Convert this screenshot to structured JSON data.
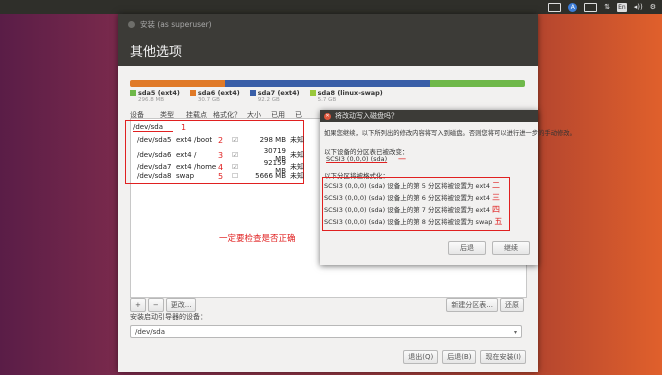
{
  "tray": {
    "acc": "A",
    "box": "En",
    "vol": "◂))",
    "gear": "⚙"
  },
  "window": {
    "title": "安装 (as superuser)",
    "page_title": "其他选项"
  },
  "disk_bar": {
    "segments": [
      {
        "color": "#e07a28",
        "fraction": 0.24
      },
      {
        "color": "#3a5fa8",
        "fraction": 0.52
      },
      {
        "color": "#6fb84a",
        "fraction": 0.24
      }
    ]
  },
  "legend": [
    {
      "label": "sda5 (ext4)",
      "size": "296.8 MB",
      "color": "#6fb84a"
    },
    {
      "label": "sda6 (ext4)",
      "size": "30.7 GB",
      "color": "#e07a28"
    },
    {
      "label": "sda7 (ext4)",
      "size": "92.2 GB",
      "color": "#3a5fa8"
    },
    {
      "label": "sda8 (linux-swap)",
      "size": "5.7 GB",
      "color": "#9ac83c"
    }
  ],
  "columns": [
    "设备",
    "类型",
    "挂载点",
    "格式化？",
    "大小",
    "已用",
    "已"
  ],
  "partitions": {
    "disk": "/dev/sda",
    "disk_anno": "1",
    "rows": [
      {
        "device": "/dev/sda5",
        "type": "ext4",
        "mount": "/boot",
        "anno": "2",
        "checked": "☑",
        "size": "298 MB",
        "used": "未知"
      },
      {
        "device": "/dev/sda6",
        "type": "ext4",
        "mount": "/",
        "anno": "3",
        "checked": "☑",
        "size": "30719 MB",
        "used": "未知"
      },
      {
        "device": "/dev/sda7",
        "type": "ext4",
        "mount": "/home",
        "anno": "4",
        "checked": "☑",
        "size": "92159 MB",
        "used": "未知"
      },
      {
        "device": "/dev/sda8",
        "type": "swap",
        "mount": "",
        "anno": "5",
        "checked": "☐",
        "size": "5666 MB",
        "used": "未知"
      }
    ],
    "note": "一定要检查是否正确"
  },
  "tools": {
    "add": "+",
    "remove": "−",
    "change": "更改...",
    "new_table": "新建分区表...",
    "revert": "还原"
  },
  "boot": {
    "label": "安装启动引导器的设备：",
    "value": "/dev/sda",
    "arrow": "▾"
  },
  "nav": {
    "quit": "退出(Q)",
    "back": "后退(B)",
    "install_now": "现在安装(I)"
  },
  "dialog": {
    "title": "将改动写入磁盘吗？",
    "close": "✕",
    "intro": "如果您继续，以下所列出的修改内容将写入到磁盘。否则您将可以进行进一步的手动修改。",
    "changed_label": "以下设备的分区表已被改变：",
    "changed_device": "SCSI3 (0,0,0) (sda)",
    "changed_anno": "一",
    "format_label": "以下分区将被格式化：",
    "format_items": [
      {
        "text": "SCSI3 (0,0,0) (sda) 设备上的第 5 分区将被设置为 ext4",
        "anno": "二"
      },
      {
        "text": "SCSI3 (0,0,0) (sda) 设备上的第 6 分区将被设置为 ext4",
        "anno": "三"
      },
      {
        "text": "SCSI3 (0,0,0) (sda) 设备上的第 7 分区将被设置为 ext4",
        "anno": "四"
      },
      {
        "text": "SCSI3 (0,0,0) (sda) 设备上的第 8 分区将被设置为 swap",
        "anno": "五"
      }
    ],
    "back": "后退",
    "continue": "继续"
  }
}
